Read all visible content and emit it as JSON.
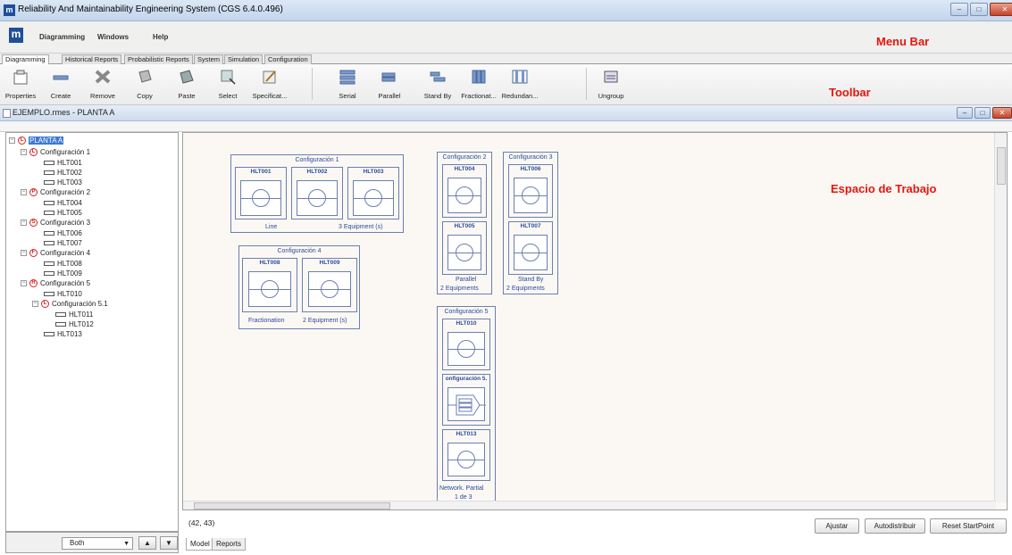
{
  "window": {
    "title": "Reliability And Maintainability Engineering System (CGS 6.4.0.496)",
    "logo": "m"
  },
  "menu": {
    "items": [
      "Diagramming",
      "Windows",
      "Help"
    ]
  },
  "annotations": {
    "menu_bar": "Menu Bar",
    "toolbar": "Toolbar",
    "workspace": "Espacio de Trabajo"
  },
  "tabs": [
    "Diagramming",
    "Historical Reports",
    "Probabilistic Reports",
    "System",
    "Simulation",
    "Configuration"
  ],
  "toolbar": {
    "buttons": [
      {
        "label": "Properties",
        "icon": "properties-icon"
      },
      {
        "label": "Create",
        "icon": "create-icon"
      },
      {
        "label": "Remove",
        "icon": "remove-icon"
      },
      {
        "label": "Copy",
        "icon": "copy-icon"
      },
      {
        "label": "Paste",
        "icon": "paste-icon"
      },
      {
        "label": "Select",
        "icon": "select-icon"
      },
      {
        "label": "Specificat...",
        "icon": "specification-icon"
      },
      {
        "label": "Serial",
        "icon": "serial-icon"
      },
      {
        "label": "Parallel",
        "icon": "parallel-icon"
      },
      {
        "label": "Stand By",
        "icon": "standby-icon"
      },
      {
        "label": "Fractionat...",
        "icon": "fractionation-icon"
      },
      {
        "label": "Redundan...",
        "icon": "redundancy-icon"
      },
      {
        "label": "Ungroup",
        "icon": "ungroup-icon"
      }
    ]
  },
  "document": {
    "title": "EJEMPLO.rmes - PLANTA A"
  },
  "tree": {
    "nodes": [
      {
        "label": "PLANTA A",
        "badge": "L"
      },
      {
        "label": "Configuración 1",
        "badge": "L"
      },
      {
        "label": "HLT001"
      },
      {
        "label": "HLT002"
      },
      {
        "label": "HLT003"
      },
      {
        "label": "Configuración 2",
        "badge": "P"
      },
      {
        "label": "HLT004"
      },
      {
        "label": "HLT005"
      },
      {
        "label": "Configuración 3",
        "badge": "S"
      },
      {
        "label": "HLT006"
      },
      {
        "label": "HLT007"
      },
      {
        "label": "Configuración 4",
        "badge": "F"
      },
      {
        "label": "HLT008"
      },
      {
        "label": "HLT009"
      },
      {
        "label": "Configuración 5",
        "badge": "R"
      },
      {
        "label": "HLT010"
      },
      {
        "label": "Configuración 5.1",
        "badge": "L"
      },
      {
        "label": "HLT011"
      },
      {
        "label": "HLT012"
      },
      {
        "label": "HLT013"
      }
    ],
    "filter": "Both"
  },
  "diagram": {
    "config1": {
      "title": "Configuración 1",
      "equipment": [
        "HLT001",
        "HLT002",
        "HLT003"
      ],
      "type_label": "Line",
      "count_label": "3 Equipment (s)"
    },
    "config2": {
      "title": "Configuración 2",
      "equipment": [
        "HLT004",
        "HLT005"
      ],
      "type_label": "Parallel",
      "count_label": "2 Equipments"
    },
    "config3": {
      "title": "Configuración 3",
      "equipment": [
        "HLT006",
        "HLT007"
      ],
      "type_label": "Stand By",
      "count_label": "2 Equipments"
    },
    "config4": {
      "title": "Configuración 4",
      "equipment": [
        "HLT008",
        "HLT009"
      ],
      "type_label": "Fractionation",
      "count_label": "2 Equipment (s)"
    },
    "config5": {
      "title": "Configuración 5",
      "equipment": [
        "HLT010",
        "onfiguración 5.",
        "HLT013"
      ],
      "type_label": "Network. Partial",
      "count_label": "1 de 3"
    }
  },
  "status": {
    "coords": "(42, 43)",
    "buttons": [
      "Ajustar",
      "Autodistribuir",
      "Reset StartPoint"
    ]
  },
  "bottom_tabs": [
    "Model",
    "Reports"
  ]
}
